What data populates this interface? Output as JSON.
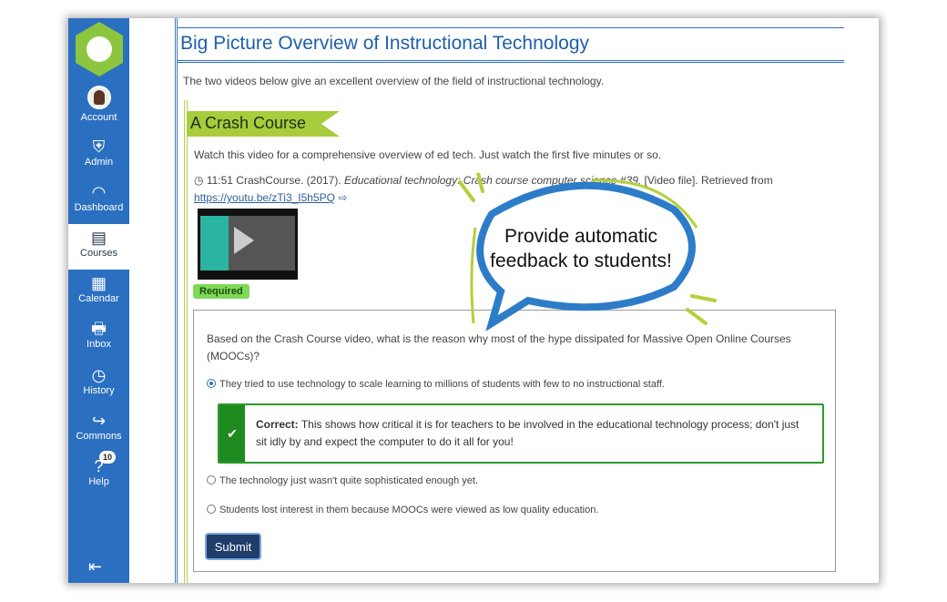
{
  "sidebar": {
    "items": [
      {
        "label": "Account",
        "icon": "avatar"
      },
      {
        "label": "Admin",
        "icon": "shield-icon"
      },
      {
        "label": "Dashboard",
        "icon": "speedometer-icon"
      },
      {
        "label": "Courses",
        "icon": "book-icon",
        "active": true
      },
      {
        "label": "Calendar",
        "icon": "calendar-icon"
      },
      {
        "label": "Inbox",
        "icon": "inbox-icon"
      },
      {
        "label": "History",
        "icon": "clock-icon"
      },
      {
        "label": "Commons",
        "icon": "share-icon"
      },
      {
        "label": "Help",
        "icon": "help-icon",
        "badge": "10"
      }
    ]
  },
  "page": {
    "title": "Big Picture Overview of Instructional Technology",
    "intro": "The two videos below give an excellent overview of the field of instructional technology."
  },
  "section": {
    "heading": "A Crash Course",
    "instruction": "Watch this video for a comprehensive overview of ed tech.  Just watch the first five minutes or so.",
    "duration": "11:51",
    "citation_pre": "CrashCourse. (2017). ",
    "citation_title": "Educational technology: Crash course computer science #39.",
    "citation_post": "  [Video file]. Retrieved from",
    "link": "https://youtu.be/zTi3_I5h5PQ",
    "required": "Required"
  },
  "quiz": {
    "question": "Based on the Crash Course video, what is the reason why most of the hype dissipated for Massive Open Online Courses (MOOCs)?",
    "options": [
      "They tried to use technology to scale learning to millions of students with few to no instructional staff.",
      "The technology just wasn't quite sophisticated enough yet.",
      "Students lost interest in them because MOOCs were viewed as low quality education."
    ],
    "selected": 0,
    "feedback_label": "Correct:",
    "feedback": "This shows how critical it is for teachers to be involved in the educational technology process; don't just sit idly by and expect the computer to do it all for you!",
    "submit": "Submit"
  },
  "callout": "Provide automatic feedback to students!",
  "colors": {
    "sidebar": "#2b6fc0",
    "accent": "#a8cc3c",
    "correct": "#1f8a1f"
  }
}
